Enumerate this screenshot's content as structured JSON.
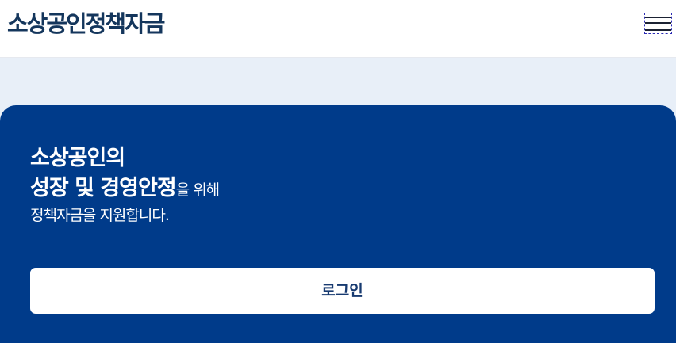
{
  "header": {
    "title": "소상공인정책자금",
    "menu_icon": "hamburger-menu-icon"
  },
  "hero": {
    "line1": "소상공인의",
    "line2_strong": "성장 및 경영안정",
    "line2_normal": "을 위해",
    "line3": "정책자금을 지원합니다.",
    "login_label": "로그인"
  },
  "colors": {
    "title_text": "#14365c",
    "hero_background": "#003b8a",
    "page_backdrop": "#e8eff8",
    "button_background": "#ffffff",
    "button_text": "#173a70"
  }
}
